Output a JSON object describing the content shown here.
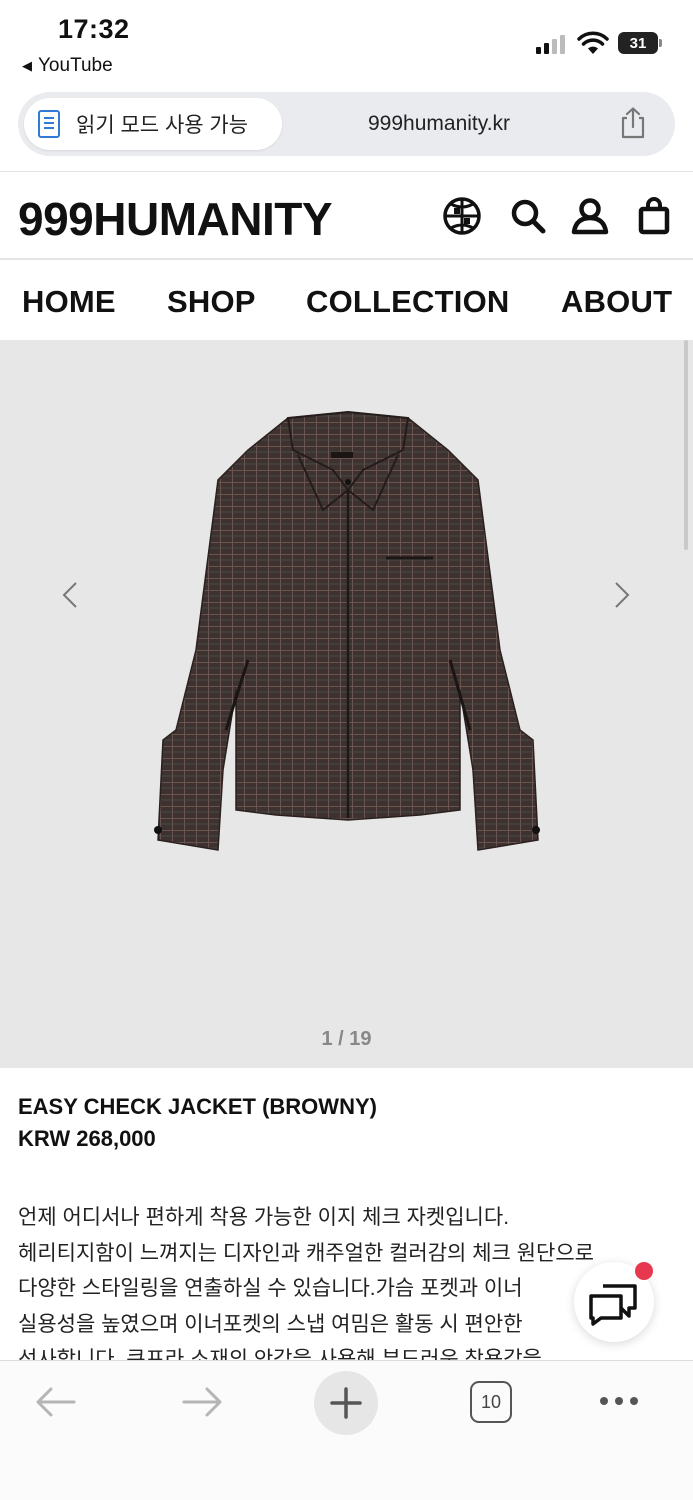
{
  "status": {
    "time": "17:32",
    "back_app": "YouTube",
    "battery": "31"
  },
  "browser": {
    "reader_mode": "읽기 모드 사용 가능",
    "domain": "999humanity.kr",
    "tab_count": "10"
  },
  "site": {
    "logo": "999HUMANITY",
    "nav": [
      "HOME",
      "SHOP",
      "COLLECTION",
      "ABOUT"
    ]
  },
  "product": {
    "pager": "1 / 19",
    "name": "EASY CHECK JACKET (BROWNY)",
    "price": "KRW 268,000",
    "description": [
      "언제 어디서나 편하게 착용 가능한 이지 체크 자켓입니다.",
      "헤리티지함이 느껴지는 디자인과 캐주얼한 컬러감의 체크 원단으로",
      "다양한 스타일링을 연출하실 수 있습니다.가슴 포켓과 이너",
      "실용성을 높였으며 이너포켓의 스냅 여밈은 활동 시 편안한",
      "선사합니다. 큐프라 소재의 안감을 사용해 부드러운 착용감을"
    ]
  },
  "colors": {
    "gallery_bg": "#e7e7e7",
    "reader_icon": "#2f7bd6",
    "notification_dot": "#e8384f"
  }
}
